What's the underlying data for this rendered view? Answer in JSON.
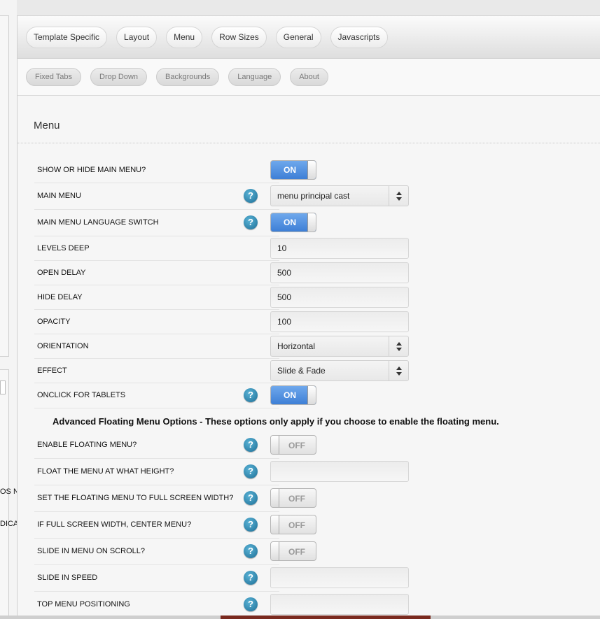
{
  "left_crop": {
    "text1": "OS N",
    "text2": "DICA"
  },
  "tabs_primary": [
    "Template Specific",
    "Layout",
    "Menu",
    "Row Sizes",
    "General",
    "Javascripts"
  ],
  "tabs_secondary": [
    "Fixed Tabs",
    "Drop Down",
    "Backgrounds",
    "Language",
    "About"
  ],
  "section_title": "Menu",
  "help_glyph": "?",
  "rows": [
    {
      "label": "SHOW OR HIDE MAIN MENU?",
      "help": false,
      "control": "toggle",
      "value": "ON"
    },
    {
      "label": "MAIN MENU",
      "help": true,
      "control": "select",
      "value": "menu principal cast"
    },
    {
      "label": "MAIN MENU LANGUAGE SWITCH",
      "help": true,
      "control": "toggle",
      "value": "ON"
    },
    {
      "label": "LEVELS DEEP",
      "help": false,
      "control": "field",
      "value": "10"
    },
    {
      "label": "OPEN DELAY",
      "help": false,
      "control": "field",
      "value": "500"
    },
    {
      "label": "HIDE DELAY",
      "help": false,
      "control": "field",
      "value": "500"
    },
    {
      "label": "OPACITY",
      "help": false,
      "control": "field",
      "value": "100"
    },
    {
      "label": "ORIENTATION",
      "help": false,
      "control": "select",
      "value": "Horizontal"
    },
    {
      "label": "EFFECT",
      "help": false,
      "control": "select",
      "value": "Slide & Fade"
    },
    {
      "label": "ONCLICK FOR TABLETS",
      "help": true,
      "control": "toggle",
      "value": "ON"
    }
  ],
  "advanced_heading": "Advanced Floating Menu Options - These options only apply if you choose to enable the floating menu.",
  "floating_rows": [
    {
      "label": "ENABLE FLOATING MENU?",
      "help": true,
      "control": "toggle",
      "value": "OFF"
    },
    {
      "label": "FLOAT THE MENU AT WHAT HEIGHT?",
      "help": true,
      "control": "field",
      "value": ""
    },
    {
      "label": "SET THE FLOATING MENU TO FULL SCREEN WIDTH?",
      "help": true,
      "control": "toggle",
      "value": "OFF"
    },
    {
      "label": "IF FULL SCREEN WIDTH, CENTER MENU?",
      "help": true,
      "control": "toggle",
      "value": "OFF"
    },
    {
      "label": "SLIDE IN MENU ON SCROLL?",
      "help": true,
      "control": "toggle",
      "value": "OFF"
    },
    {
      "label": "SLIDE IN SPEED",
      "help": true,
      "control": "field",
      "value": ""
    },
    {
      "label": "TOP MENU POSITIONING",
      "help": true,
      "control": "field",
      "value": ""
    }
  ],
  "colors": {
    "toggle_on": "#3d7fd6",
    "help_icon": "#1d6e96"
  }
}
